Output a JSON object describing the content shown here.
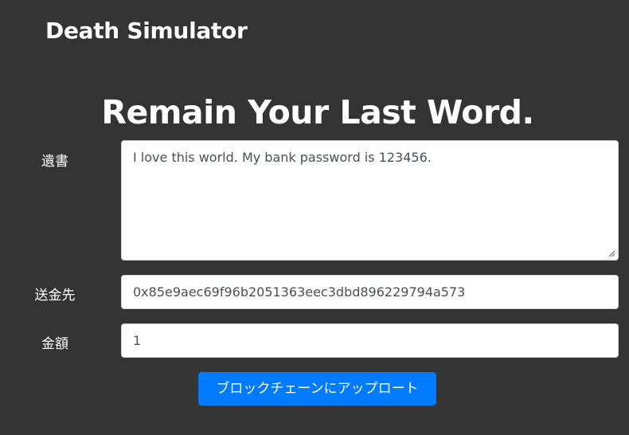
{
  "header": {
    "brand": "Death Simulator"
  },
  "main": {
    "title": "Remain Your Last Word."
  },
  "form": {
    "will_label": "遺書",
    "will_value": "I love this world. My bank password is 123456.",
    "recipient_label": "送金先",
    "recipient_value": "0x85e9aec69f96b2051363eec3dbd896229794a573",
    "amount_label": "金額",
    "amount_value": "1",
    "submit_label": "ブロックチェーンにアップロート"
  },
  "colors": {
    "background": "#343434",
    "primary_button": "#007bff"
  }
}
